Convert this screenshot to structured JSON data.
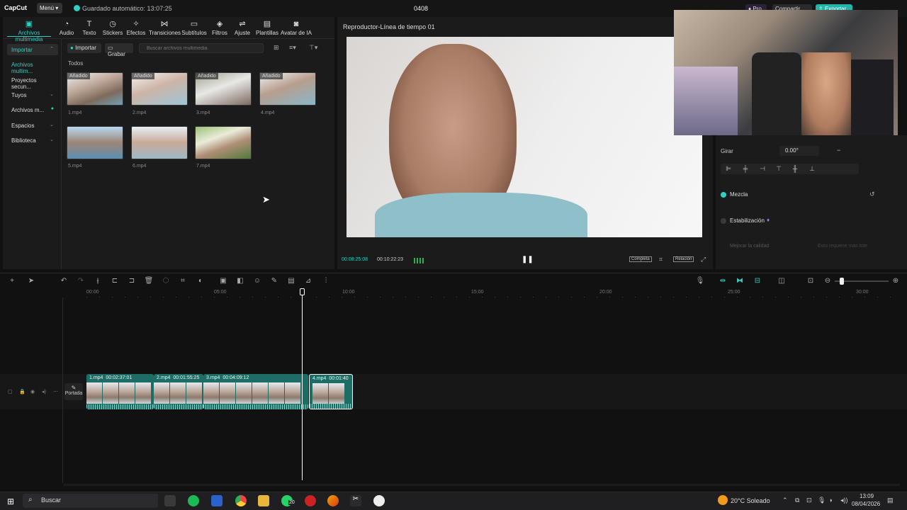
{
  "app": {
    "logo": "CapCut",
    "menu_label": "Menú",
    "autosave": "Guardado automático: 13:07:25",
    "project_title": "0408",
    "pro_label": "Pro",
    "share_label": "Compartir",
    "export_label": "Exportar"
  },
  "toolbar": [
    {
      "label": "Archivos multimedia",
      "icon": "media-icon"
    },
    {
      "label": "Audio",
      "icon": "audio-icon"
    },
    {
      "label": "Texto",
      "icon": "text-icon"
    },
    {
      "label": "Stickers",
      "icon": "sticker-icon"
    },
    {
      "label": "Efectos",
      "icon": "effects-icon"
    },
    {
      "label": "Transiciones",
      "icon": "transition-icon"
    },
    {
      "label": "Subtítulos",
      "icon": "subtitle-icon"
    },
    {
      "label": "Filtros",
      "icon": "filter-icon"
    },
    {
      "label": "Ajuste",
      "icon": "adjust-icon"
    },
    {
      "label": "Plantillas",
      "icon": "template-icon"
    },
    {
      "label": "Avatar de IA",
      "icon": "avatar-icon"
    }
  ],
  "left_nav": [
    "Importar",
    "Archivos multim...",
    "Proyectos secun...",
    "Tuyos",
    "Archivos m...",
    "Espacios",
    "Biblioteca"
  ],
  "media": {
    "import_label": "Importar",
    "record_label": "Grabar",
    "search_placeholder": "Buscar archivos multimedia",
    "section_label": "Todos",
    "added_tag": "Añadido",
    "files": [
      "1.mp4",
      "2.mp4",
      "3.mp4",
      "4.mp4",
      "5.mp4",
      "6.mp4",
      "7.mp4"
    ]
  },
  "player": {
    "title": "Reproductor-Línea de tiempo 01",
    "current_time": "00:08:25:08",
    "total_time": "00:10:22:23",
    "full_label": "Completa",
    "ratio_label": "Relación"
  },
  "properties": {
    "rotate_label": "Girar",
    "rotate_value": "0.00°",
    "blend_label": "Mezcla",
    "stabilize_label": "Estabilización",
    "quality_label": "Mejorar la calidad",
    "quality_hint": "Esto requiere más lote"
  },
  "timeline": {
    "ruler": [
      "00:00",
      "05:00",
      "10:00",
      "15:00",
      "20:00",
      "25:00",
      "30:00"
    ],
    "cover_label": "Portada",
    "clips": [
      {
        "name": "1.mp4",
        "duration": "00:02:37:01"
      },
      {
        "name": "2.mp4",
        "duration": "00:01:55:25"
      },
      {
        "name": "3.mp4",
        "duration": "00:04:09:12"
      },
      {
        "name": "4.mp4",
        "duration": "00:01:40"
      }
    ]
  },
  "taskbar": {
    "search_label": "Buscar",
    "weather": "20°C Soleado",
    "time": "13:09",
    "date": "08/04/2026",
    "badge": "20"
  }
}
